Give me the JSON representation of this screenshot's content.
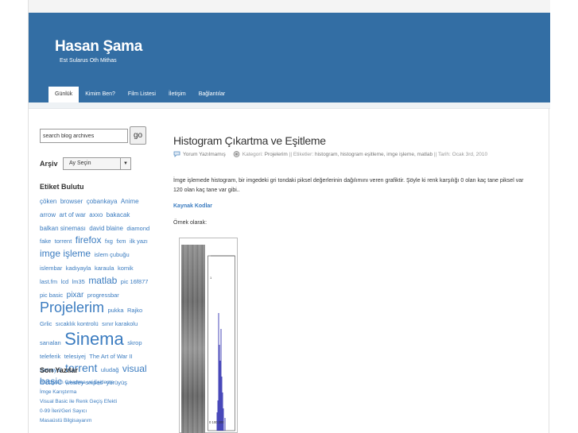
{
  "site": {
    "title": "Hasan Şama",
    "description": "Est Sularus Oth Mithas"
  },
  "nav": [
    {
      "label": "Günlük",
      "active": true
    },
    {
      "label": "Kimim Ben?",
      "active": false
    },
    {
      "label": "Film Listesi",
      "active": false
    },
    {
      "label": "İletişim",
      "active": false
    },
    {
      "label": "Bağlantılar",
      "active": false
    }
  ],
  "sidebar": {
    "search_value": "search blog archives",
    "search_button": "go",
    "archive_label": "Arşiv",
    "archive_select": "Ay Seçin",
    "tagcloud_title": "Etiket Bulutu",
    "tags": [
      {
        "text": "çöken",
        "size": 8
      },
      {
        "text": "browser",
        "size": 8
      },
      {
        "text": "çobankaya",
        "size": 8
      },
      {
        "text": "Anime",
        "size": 8
      },
      {
        "text": "arrow",
        "size": 8
      },
      {
        "text": "art of war",
        "size": 8
      },
      {
        "text": "axxo",
        "size": 8
      },
      {
        "text": "bakacak",
        "size": 8
      },
      {
        "text": "balkan sineması",
        "size": 8
      },
      {
        "text": "david blaine",
        "size": 8
      },
      {
        "text": "diamond",
        "size": 7.5
      },
      {
        "text": "fake",
        "size": 7.5
      },
      {
        "text": "torrent",
        "size": 7.5
      },
      {
        "text": "firefox",
        "size": 12
      },
      {
        "text": "fxg",
        "size": 7.5
      },
      {
        "text": "fxm",
        "size": 7.5
      },
      {
        "text": "ilk yazı",
        "size": 7.5
      },
      {
        "text": "imge işleme",
        "size": 12
      },
      {
        "text": "islem çubuğu",
        "size": 7.5
      },
      {
        "text": "islembar",
        "size": 7.5
      },
      {
        "text": "kadıyayla",
        "size": 7.5
      },
      {
        "text": "karaula",
        "size": 7.5
      },
      {
        "text": "komik",
        "size": 7.5
      },
      {
        "text": "last.fm",
        "size": 7.5
      },
      {
        "text": "lcd",
        "size": 7.5
      },
      {
        "text": "lm35",
        "size": 7.5
      },
      {
        "text": "matlab",
        "size": 12
      },
      {
        "text": "pic 16f877",
        "size": 7.5
      },
      {
        "text": "pic basic",
        "size": 7.5
      },
      {
        "text": "pixar",
        "size": 10
      },
      {
        "text": "progressbar",
        "size": 7.5
      },
      {
        "text": "Projelerim",
        "size": 18
      },
      {
        "text": "pukka",
        "size": 7.5
      },
      {
        "text": "Rajko Grlic",
        "size": 7.5
      },
      {
        "text": "sıcaklık kontrolü",
        "size": 7.5
      },
      {
        "text": "sınır karakolu",
        "size": 7.5
      },
      {
        "text": "sarıalan",
        "size": 7.5
      },
      {
        "text": "Sinema",
        "size": 22
      },
      {
        "text": "skrop",
        "size": 7.5
      },
      {
        "text": "teleferik",
        "size": 7.5
      },
      {
        "text": "telesiyej",
        "size": 7.5
      },
      {
        "text": "The Art of War II Betrayal",
        "size": 7.5
      },
      {
        "text": "torrent",
        "size": 14
      },
      {
        "text": "uludağ",
        "size": 7.5
      },
      {
        "text": "visual basic",
        "size": 12
      },
      {
        "text": "wesley snipes",
        "size": 7.5
      },
      {
        "text": "yürüyüş",
        "size": 7.5
      }
    ],
    "recent_title": "Son Yazılar",
    "recent_posts": [
      "Histogram Çıkartma ve Eşitleme",
      "İmge Karıştırma",
      "Visual Basic ile Renk Geçiş Efekti",
      "0-99 İleri/Geri Sayıcı",
      "Masaüstü Bilgisayarım"
    ]
  },
  "post": {
    "title": "Histogram Çıkartma ve Eşitleme",
    "comments": "Yorum Yazılmamış",
    "category_label": "Kategori:",
    "category": "Projelerim",
    "tags_label": "|| Etiketler:",
    "tags": "histogram, histogram eşitleme, imge işleme, matlab",
    "date_label": "|| Tarih:",
    "date": "Ocak 3rd, 2010",
    "body": "İmge işlemede histogram, bir imgedeki gri tondaki piksel değerlerinin dağılımını veren grafiktir. Şöyle ki renk karşılığı 0 olan kaç tane piksel var 120 olan kaç tane var gibi..",
    "source_link": "Kaynak Kodlar",
    "example_label": "Örnek olarak:",
    "figure_tick": "1",
    "figure_xlabel": "0 100 200"
  },
  "colors": {
    "header_bg": "#336ea4",
    "link": "#3b7cc0"
  }
}
